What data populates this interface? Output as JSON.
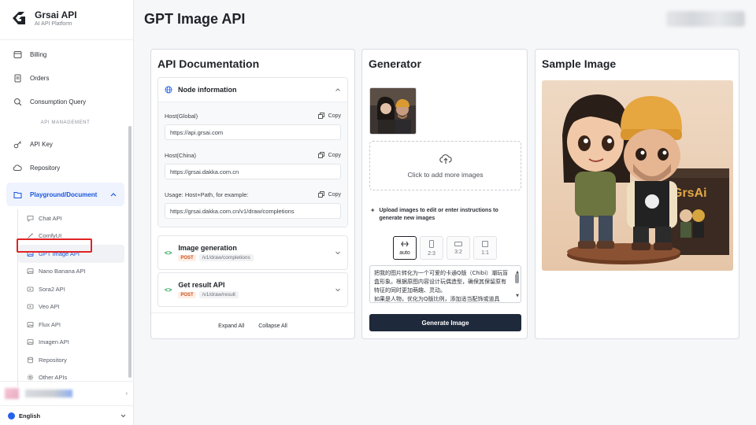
{
  "brand": {
    "name": "Grsai API",
    "subtitle": "AI API Platform"
  },
  "sidebar": {
    "items": [
      {
        "label": "Billing",
        "icon": "billing-icon"
      },
      {
        "label": "Orders",
        "icon": "orders-icon"
      },
      {
        "label": "Consumption Query",
        "icon": "search-icon"
      }
    ],
    "section_label": "API MANAGEMENT",
    "mgmt_items": [
      {
        "label": "API Key",
        "icon": "key-icon"
      },
      {
        "label": "Repository",
        "icon": "cloud-icon"
      }
    ],
    "active_group": {
      "label": "Playground/Document",
      "icon": "folder-icon"
    },
    "sub_items": [
      {
        "label": "Chat API"
      },
      {
        "label": "ComfyUI"
      },
      {
        "label": "GPT Image API"
      },
      {
        "label": "Nano Banana API"
      },
      {
        "label": "Sora2 API"
      },
      {
        "label": "Veo API"
      },
      {
        "label": "Flux API"
      },
      {
        "label": "Imagen API"
      },
      {
        "label": "Repository"
      },
      {
        "label": "Other APIs"
      }
    ],
    "language": "English"
  },
  "header": {
    "title": "GPT Image API"
  },
  "docs": {
    "title": "API Documentation",
    "node_info": {
      "title": "Node information",
      "host_global_label": "Host(Global)",
      "host_global_value": "https://api.grsai.com",
      "host_china_label": "Host(China)",
      "host_china_value": "https://grsai.dakka.com.cn",
      "usage_label": "Usage: Host+Path, for example:",
      "usage_value": "https://grsai.dakka.com.cn/v1/draw/completions",
      "copy_label": "Copy"
    },
    "endpoints": [
      {
        "title": "Image generation",
        "method": "POST",
        "path": "/v1/draw/completions"
      },
      {
        "title": "Get result API",
        "method": "POST",
        "path": "/v1/draw/result"
      }
    ],
    "expand_all": "Expand All",
    "collapse_all": "Collapse All"
  },
  "generator": {
    "title": "Generator",
    "dropzone_text": "Click to add more images",
    "hint": "Upload images to edit or enter instructions to generate new images",
    "ratios": [
      {
        "label": "auto",
        "selected": true
      },
      {
        "label": "2:3",
        "selected": false
      },
      {
        "label": "3:2",
        "selected": false
      },
      {
        "label": "1:1",
        "selected": false
      }
    ],
    "prompt": "把我的图片转化为一个可爱的卡通Q版（Chibi）潮玩盲盒形象。根据原图内容设计玩偶造型，确保其保留原有特征的同时更加萌趣、灵动。\n如果是人物，优化为Q版比例，添加适当配饰或道具",
    "button": "Generate Image"
  },
  "sample": {
    "title": "Sample Image",
    "box_text": "GrsAi"
  },
  "colors": {
    "accent": "#1a56db",
    "button_dark": "#1e293b",
    "highlight": "#e02424"
  }
}
